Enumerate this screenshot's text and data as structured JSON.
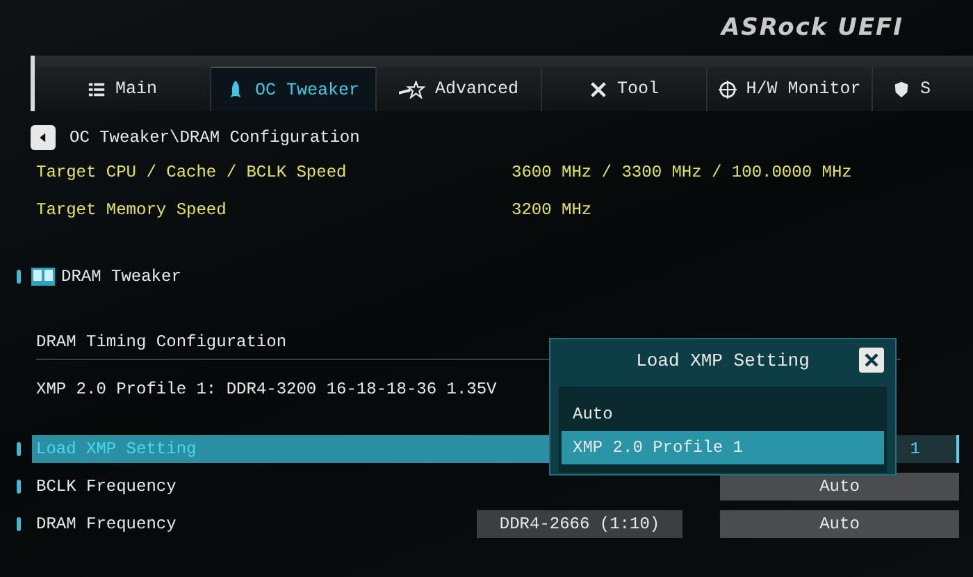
{
  "header": {
    "logo": "ASRock UEFI"
  },
  "tabs": [
    {
      "label": "Main",
      "kind": "list",
      "selected": false
    },
    {
      "label": "OC Tweaker",
      "kind": "rocket",
      "selected": true
    },
    {
      "label": "Advanced",
      "kind": "star",
      "selected": false
    },
    {
      "label": "Tool",
      "kind": "tools",
      "selected": false
    },
    {
      "label": "H/W Monitor",
      "kind": "target",
      "selected": false
    },
    {
      "label": "S",
      "kind": "shield",
      "selected": false
    }
  ],
  "breadcrumb": "OC Tweaker\\DRAM Configuration",
  "info_rows": [
    {
      "label": "Target CPU / Cache / BCLK Speed",
      "value": "3600 MHz / 3300 MHz / 100.0000 MHz"
    },
    {
      "label": "Target Memory Speed",
      "value": "3200 MHz"
    }
  ],
  "section": "DRAM Tweaker",
  "subheading": "DRAM Timing Configuration",
  "profile_text": "XMP 2.0 Profile 1: DDR4-3200 16-18-18-36 1.35V",
  "settings": [
    {
      "label": "Load XMP Setting",
      "selected": true,
      "value": "1"
    },
    {
      "label": "BCLK Frequency",
      "selected": false,
      "value": "Auto"
    },
    {
      "label": "DRAM Frequency",
      "selected": false,
      "current": "DDR4-2666 (1:10)",
      "value": "Auto"
    }
  ],
  "popup": {
    "title": "Load XMP Setting",
    "options": [
      {
        "label": "Auto",
        "selected": false
      },
      {
        "label": "XMP 2.0 Profile 1",
        "selected": true
      }
    ]
  }
}
